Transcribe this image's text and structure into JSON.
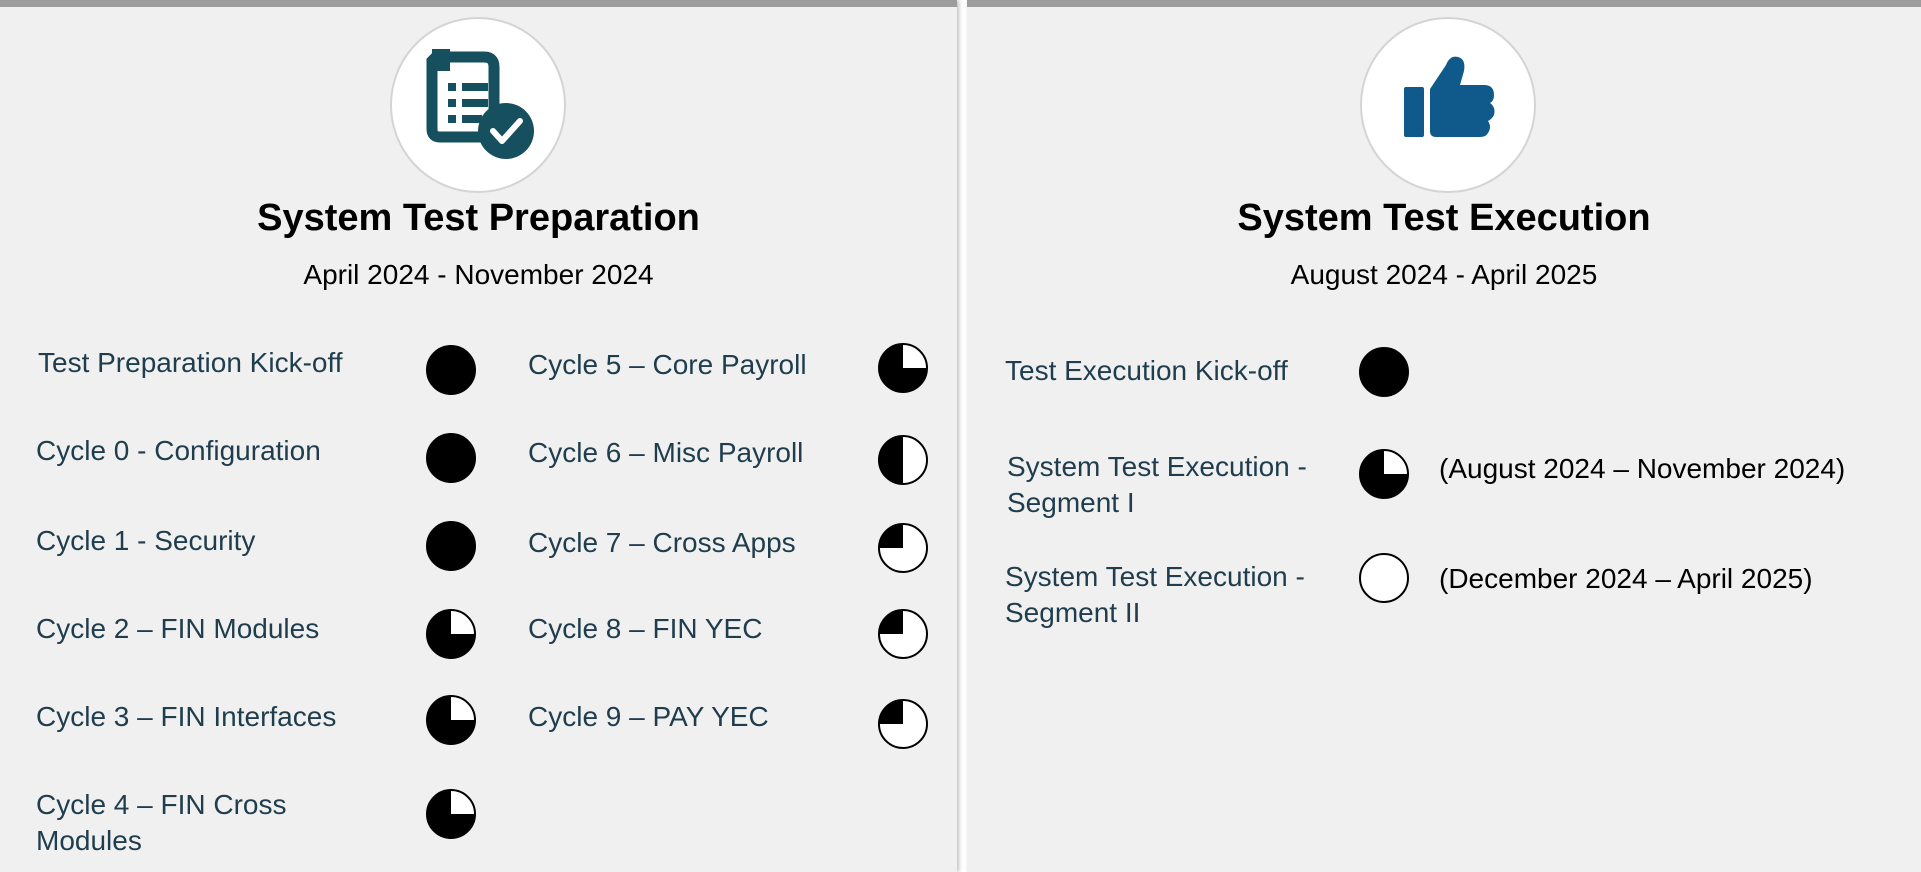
{
  "colors": {
    "accent": "#1a5276",
    "text": "#1f3d4d"
  },
  "preparation": {
    "icon": "checklist-icon",
    "title": "System Test Preparation",
    "dates": "April 2024 - November 2024",
    "items": [
      {
        "label": "Test Preparation Kick-off",
        "progress": 1.0
      },
      {
        "label": "Cycle 0 - Configuration",
        "progress": 1.0
      },
      {
        "label": "Cycle 1 - Security",
        "progress": 1.0
      },
      {
        "label": "Cycle 2 – FIN Modules",
        "progress": 0.75
      },
      {
        "label": "Cycle 3 – FIN Interfaces",
        "progress": 0.75
      },
      {
        "label": "Cycle 4 – FIN Cross Modules",
        "progress": 0.75
      },
      {
        "label": "Cycle 5 – Core Payroll",
        "progress": 0.75
      },
      {
        "label": "Cycle 6 – Misc Payroll",
        "progress": 0.5
      },
      {
        "label": "Cycle 7 – Cross Apps",
        "progress": 0.25
      },
      {
        "label": "Cycle 8 – FIN YEC",
        "progress": 0.25
      },
      {
        "label": "Cycle 9 – PAY YEC",
        "progress": 0.25
      }
    ]
  },
  "execution": {
    "icon": "thumbs-up-icon",
    "title": "System Test Execution",
    "dates": "August 2024 - April 2025",
    "items": [
      {
        "label": "Test Execution Kick-off",
        "progress": 1.0,
        "note": ""
      },
      {
        "label": "System Test Execution - Segment I",
        "progress": 0.75,
        "note": "(August 2024 – November 2024)"
      },
      {
        "label": "System Test Execution - Segment II",
        "progress": 0.0,
        "note": "(December 2024 – April 2025)"
      }
    ]
  }
}
